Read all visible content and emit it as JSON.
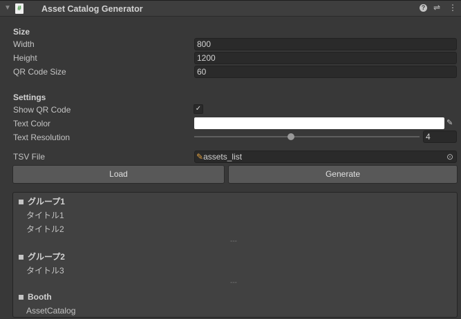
{
  "header": {
    "title": "Asset Catalog Generator"
  },
  "size": {
    "heading": "Size",
    "width_label": "Width",
    "width_value": "800",
    "height_label": "Height",
    "height_value": "1200",
    "qr_label": "QR Code Size",
    "qr_value": "60"
  },
  "settings": {
    "heading": "Settings",
    "show_qr_label": "Show QR Code",
    "show_qr_checked": true,
    "text_color_label": "Text Color",
    "text_color": "#ffffff",
    "text_res_label": "Text Resolution",
    "text_res_value": "4",
    "text_res_fraction": 0.43,
    "tsv_label": "TSV File",
    "tsv_value": "assets_list"
  },
  "buttons": {
    "load": "Load",
    "generate": "Generate"
  },
  "list": {
    "groups": [
      {
        "name": "グループ1",
        "items": [
          "タイトル1",
          "タイトル2"
        ]
      },
      {
        "name": "グループ2",
        "items": [
          "タイトル3"
        ]
      },
      {
        "name": "Booth",
        "items": [
          "AssetCatalog"
        ]
      }
    ],
    "separator": "---"
  }
}
